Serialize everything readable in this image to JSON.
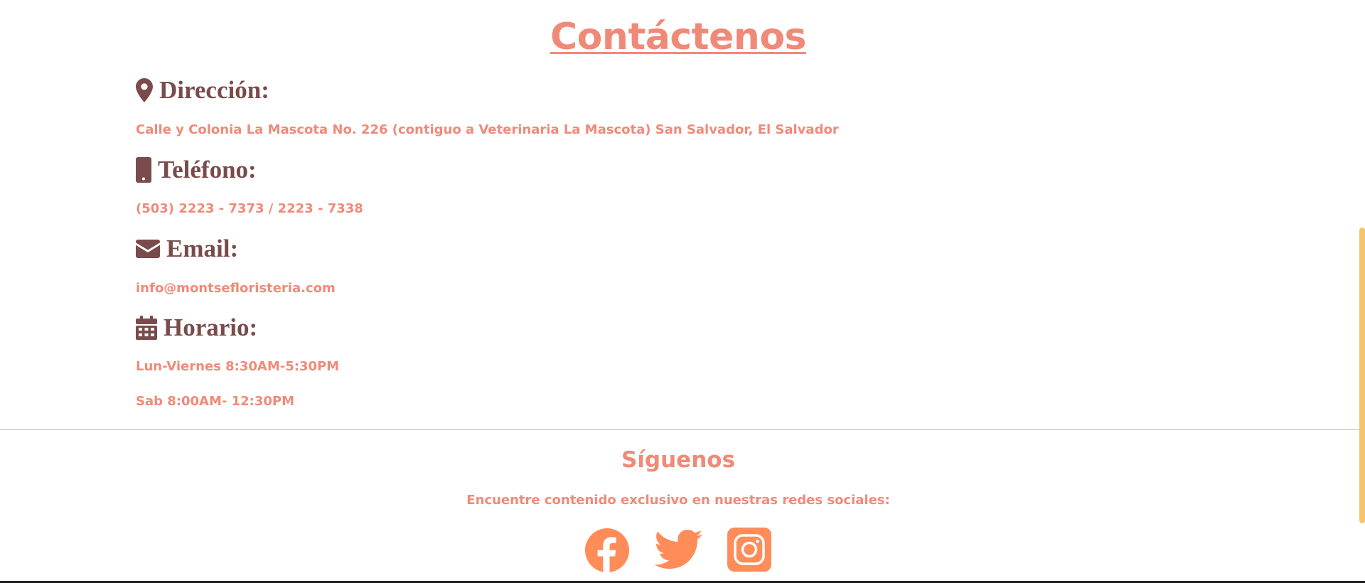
{
  "colors": {
    "accent": "#F08A78",
    "heading": "#7A4B4B",
    "social": "#FF8C59",
    "scrollbar": "#F6C46A"
  },
  "contact": {
    "title": "Contáctenos",
    "sections": [
      {
        "icon": "map-marker-icon",
        "heading": "Dirección:",
        "lines": [
          "Calle y Colonia La Mascota No. 226 (contiguo a Veterinaria La Mascota) San Salvador, El Salvador"
        ]
      },
      {
        "icon": "mobile-phone-icon",
        "heading": "Teléfono:",
        "lines": [
          "(503) 2223 - 7373 / 2223 - 7338"
        ]
      },
      {
        "icon": "envelope-icon",
        "heading": "Email:",
        "lines": [
          "info@montsefloristeria.com"
        ]
      },
      {
        "icon": "calendar-icon",
        "heading": "Horario:",
        "lines": [
          "Lun-Viernes 8:30AM-5:30PM",
          "Sab 8:00AM- 12:30PM"
        ]
      }
    ]
  },
  "follow": {
    "title": "Síguenos",
    "subtitle": "Encuentre contenido exclusivo en nuestras redes sociales:",
    "networks": [
      {
        "name": "Facebook",
        "icon": "facebook-icon"
      },
      {
        "name": "Twitter",
        "icon": "twitter-icon"
      },
      {
        "name": "Instagram",
        "icon": "instagram-icon"
      }
    ]
  }
}
